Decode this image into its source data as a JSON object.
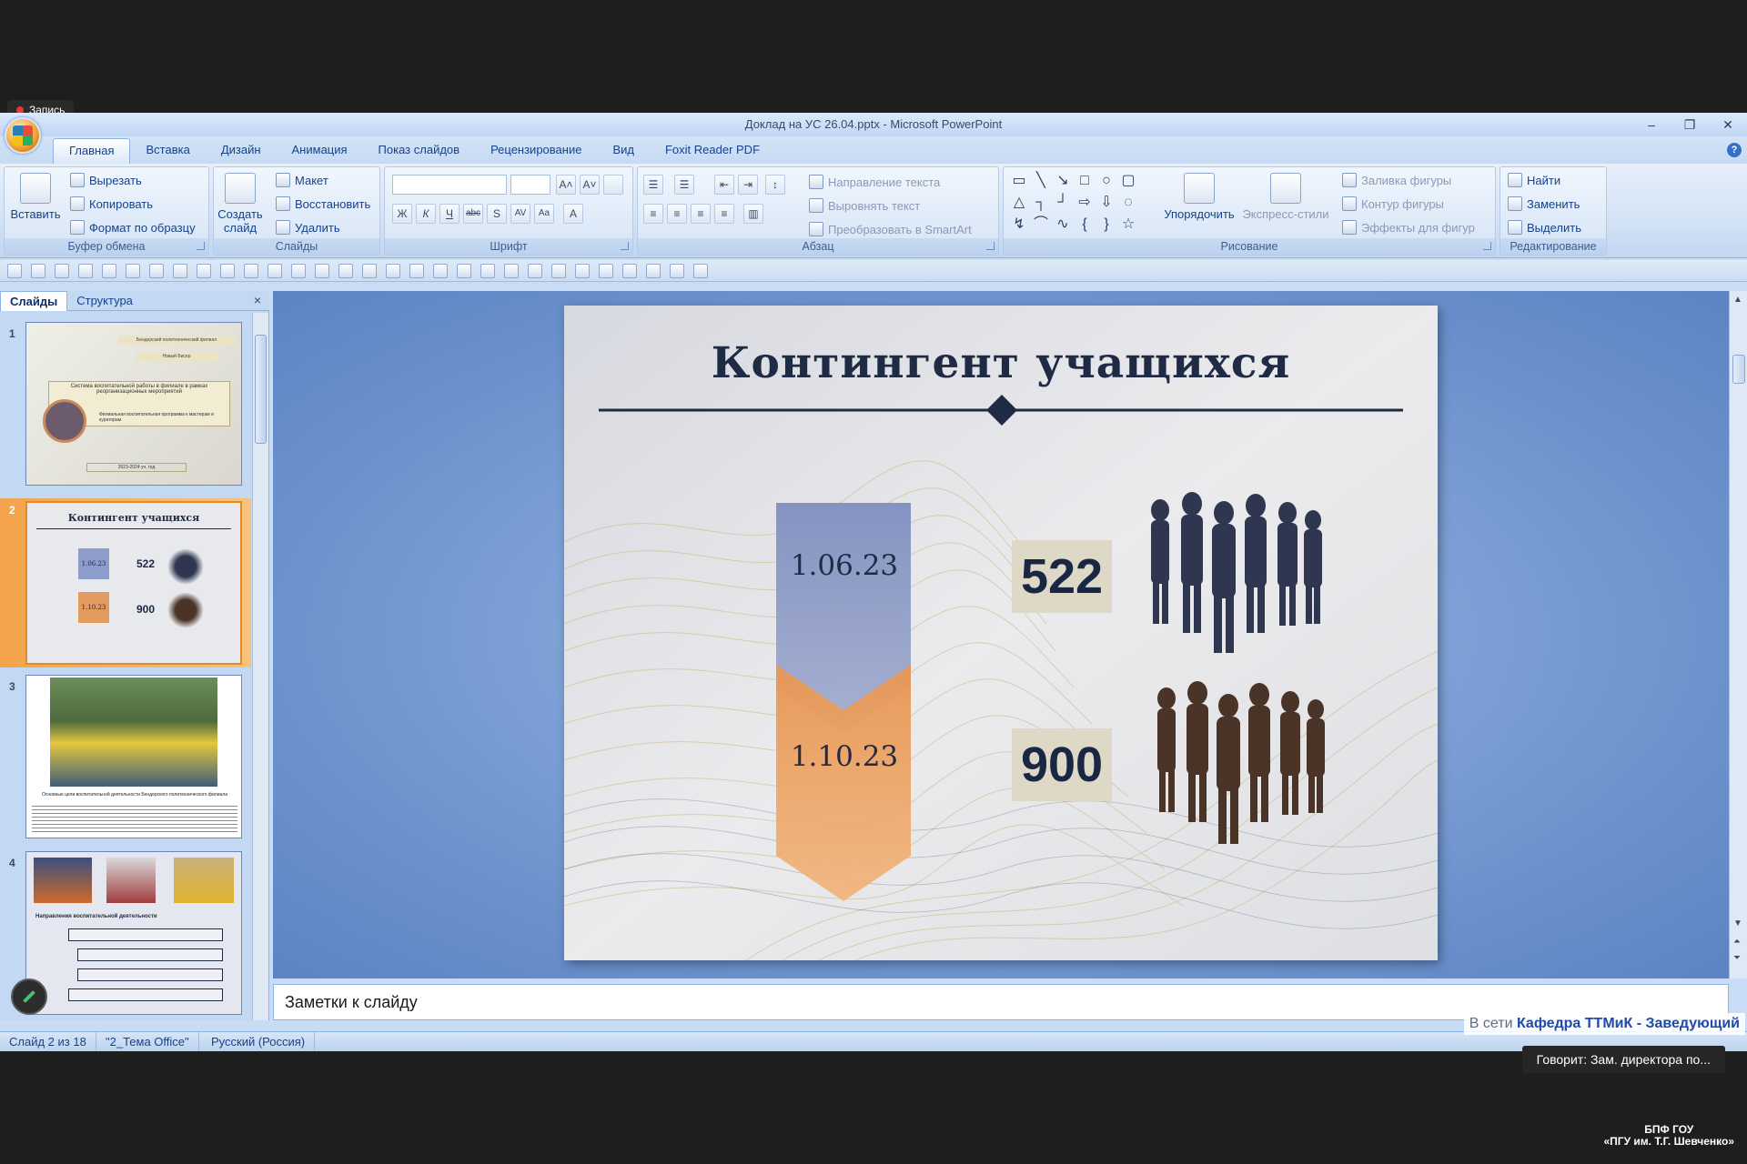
{
  "recording": {
    "label": "Запись"
  },
  "window": {
    "title": "Доклад на УС 26.04.pptx - Microsoft PowerPoint",
    "controls": {
      "min": "–",
      "max": "❐",
      "close": "✕"
    }
  },
  "ribbon_tabs": [
    "Главная",
    "Вставка",
    "Дизайн",
    "Анимация",
    "Показ слайдов",
    "Рецензирование",
    "Вид",
    "Foxit Reader PDF"
  ],
  "help": "?",
  "clipboard": {
    "paste": "Вставить",
    "cut": "Вырезать",
    "copy": "Копировать",
    "format_painter": "Формат по образцу",
    "title": "Буфер обмена"
  },
  "slides_group": {
    "new_slide": "Создать слайд",
    "layout": "Макет",
    "reset": "Восстановить",
    "delete": "Удалить",
    "title": "Слайды"
  },
  "font_group": {
    "title": "Шрифт",
    "buttons": [
      "Ж",
      "К",
      "Ч",
      "abc",
      "S",
      "AV",
      "Aa",
      "A"
    ],
    "grow": "A˄",
    "shrink": "A˅"
  },
  "paragraph_group": {
    "title": "Абзац",
    "text_direction": "Направление текста",
    "align_text": "Выровнять текст",
    "smartart": "Преобразовать в SmartArt"
  },
  "drawing_group": {
    "title": "Рисование",
    "arrange": "Упорядочить",
    "quick_styles": "Экспресс-стили",
    "shape_fill": "Заливка фигуры",
    "shape_outline": "Контур фигуры",
    "shape_effects": "Эффекты для фигур"
  },
  "editing_group": {
    "title": "Редактирование",
    "find": "Найти",
    "replace": "Заменить",
    "select": "Выделить"
  },
  "left_pane": {
    "tab_slides": "Слайды",
    "tab_outline": "Структура",
    "close": "×"
  },
  "thumbnails": [
    {
      "num": "1",
      "org": "Бендерский политехнический филиал",
      "subtitle": "Новый Бисер",
      "heading": "Система воспитательной работы в филиале в рамках реорганизационных мероприятий",
      "desc": "Филиальная воспитательная программа к мастерам и кураторам",
      "year": "2023-2024 уч. год"
    },
    {
      "num": "2",
      "title": "Контингент учащихся",
      "date1": "1.06.23",
      "date2": "1.10.23",
      "val1": "522",
      "val2": "900"
    },
    {
      "num": "3",
      "caption": "Основные цели воспитательной деятельности Бендерского политехнического филиала"
    },
    {
      "num": "4",
      "heading": "Направления воспитательной деятельности"
    }
  ],
  "slide": {
    "title": "Контингент учащихся",
    "rows": [
      {
        "date": "1.06.23",
        "value": "522",
        "color": "#8d9ccb"
      },
      {
        "date": "1.10.23",
        "value": "900",
        "color": "#e39a5d"
      }
    ]
  },
  "notes": {
    "placeholder": "Заметки к слайду"
  },
  "status": {
    "slide": "Слайд 2 из 18",
    "theme": "\"2_Тема Office\"",
    "lang": "Русский (Россия)"
  },
  "overlay": {
    "online_label": "В сети",
    "presenter": "Кафедра ТТМиК - Заведующий",
    "speaking": "Говорит: Зам. директора по..."
  },
  "watermark": {
    "line1": "БПФ ГОУ",
    "line2": "«ПГУ им. Т.Г. Шевченко»"
  },
  "colors": {
    "accent": "#15428b",
    "selected_thumb": "#f3a34a",
    "slide_title": "#1f2a44"
  }
}
